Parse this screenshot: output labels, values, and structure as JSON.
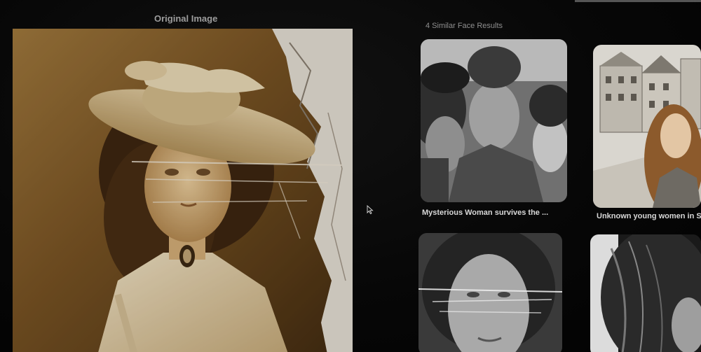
{
  "original": {
    "title": "Original Image"
  },
  "results": {
    "title": "4 Similar Face Results",
    "cards": [
      {
        "caption": "Mysterious Woman survives the ..."
      },
      {
        "caption": "Unknown young women in S"
      },
      {
        "caption": ""
      },
      {
        "caption": ""
      }
    ]
  },
  "colors": {
    "background": "#050505",
    "title_text": "#9c9c9c",
    "caption_text": "#d8d8d8",
    "sepia": "#8a6332"
  },
  "icons": [
    "mouse-cursor-icon"
  ]
}
